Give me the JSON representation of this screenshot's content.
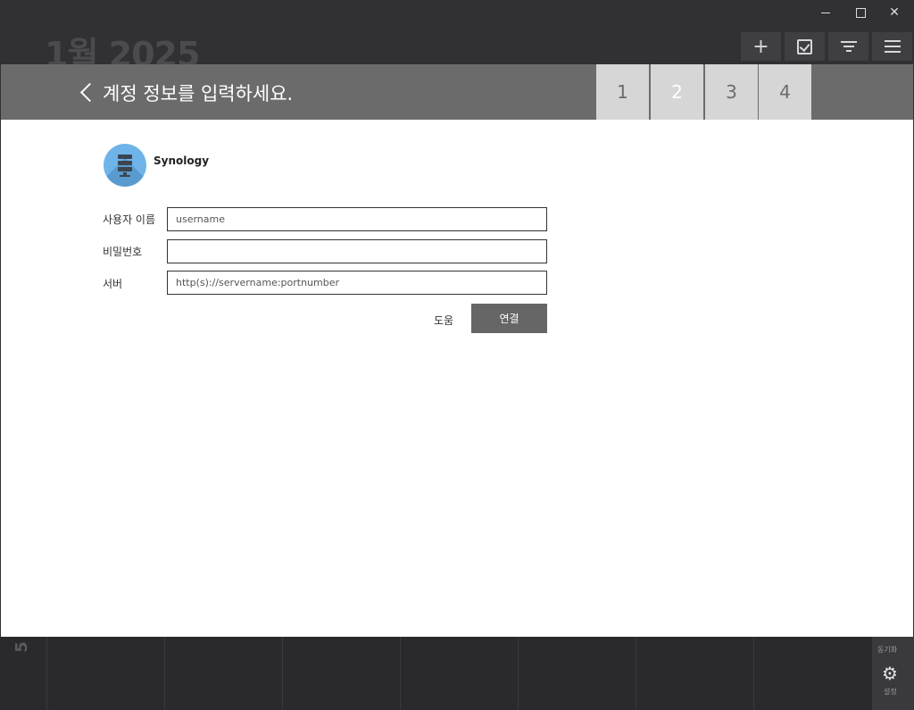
{
  "window": {
    "minimize_icon": "minimize-icon",
    "maximize_icon": "maximize-icon",
    "close_label": "✕"
  },
  "calendar": {
    "month_title": "1월 2025",
    "toolbar": {
      "add_label": "+",
      "icons": [
        "plus-icon",
        "checkbox-icon",
        "filter-icon",
        "menu-icon"
      ]
    },
    "bottom": {
      "day_number": "5",
      "sync_label": "동기화",
      "settings_label": "설정"
    }
  },
  "dialog": {
    "title": "계정 정보를 입력하세요.",
    "steps": [
      "1",
      "2",
      "3",
      "4"
    ],
    "active_step": "2",
    "brand": "Synology",
    "fields": {
      "username": {
        "label": "사용자 이름",
        "placeholder": "username",
        "value": ""
      },
      "password": {
        "label": "비밀번호",
        "placeholder": "",
        "value": ""
      },
      "server": {
        "label": "서버",
        "placeholder": "http(s)://servername:portnumber",
        "value": ""
      }
    },
    "help_label": "도움",
    "connect_label": "연결"
  },
  "colors": {
    "header_bg": "#6b6b6b",
    "step_bg": "#d6d6d6",
    "button_bg": "#666666",
    "app_bg": "#313134",
    "logo_bg": "#6fb4e8"
  }
}
